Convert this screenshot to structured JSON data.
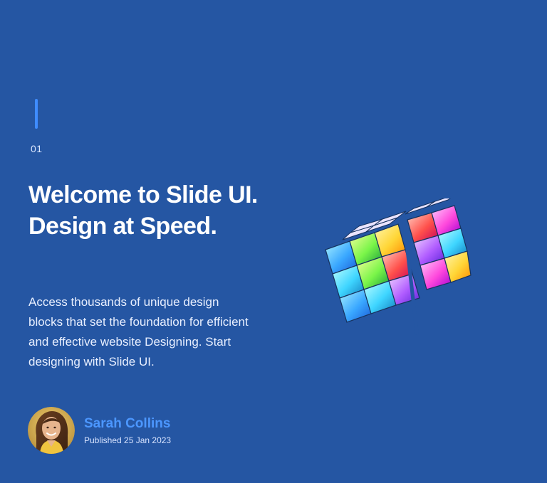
{
  "slide": {
    "number": "01",
    "title": "Welcome to Slide UI. Design at Speed.",
    "body": "Access thousands of unique design blocks that set the foundation for efficient and effective website Designing. Start designing with Slide UI."
  },
  "author": {
    "name": "Sarah Collins",
    "published": "Published 25 Jan 2023"
  },
  "colors": {
    "background": "#2556a3",
    "accent": "#3f8cff",
    "author_name": "#4c97ff"
  },
  "illustration": {
    "name": "glass-rubiks-cube"
  }
}
